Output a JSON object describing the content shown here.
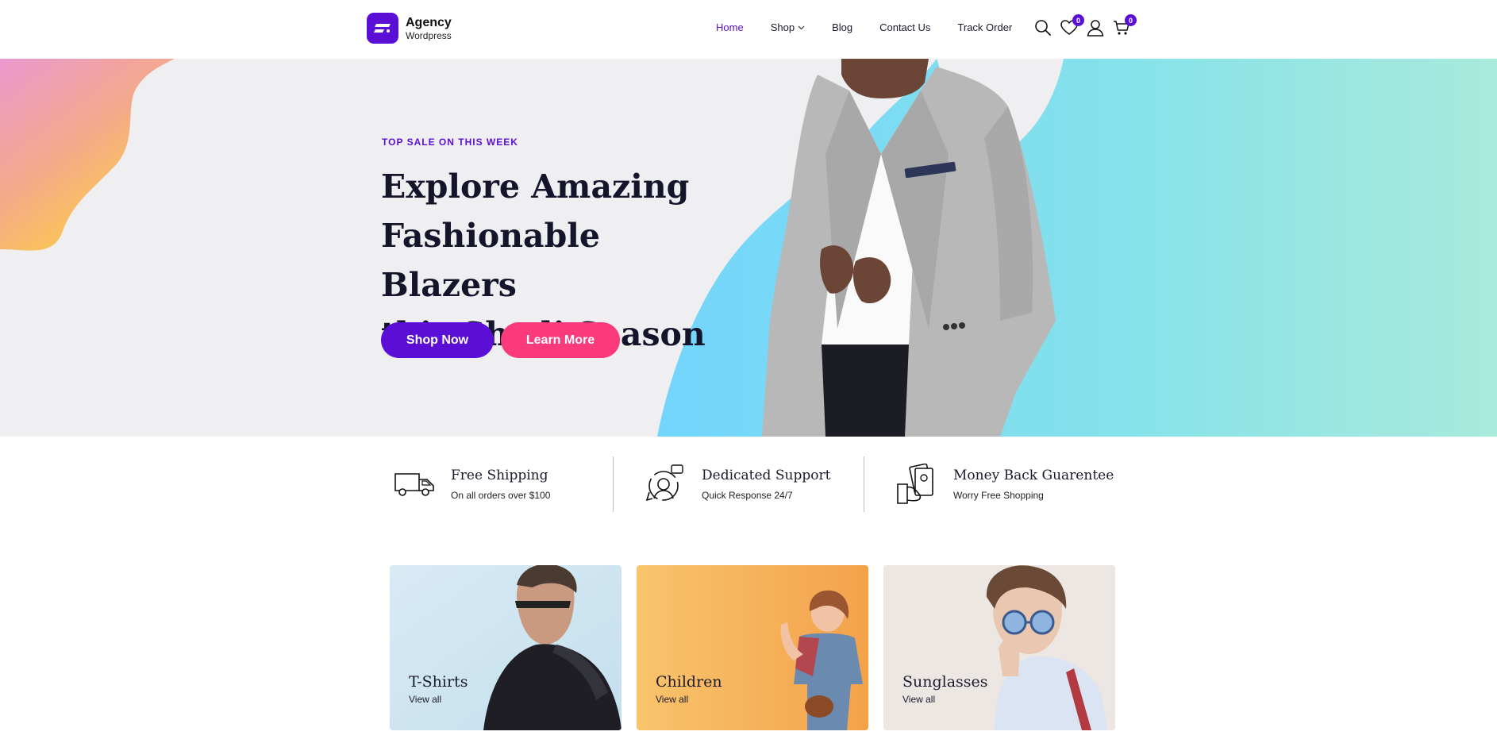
{
  "header": {
    "logo_title": "Agency",
    "logo_sub": "Wordpress",
    "nav": [
      {
        "label": "Home",
        "active": true
      },
      {
        "label": "Shop",
        "dropdown": true
      },
      {
        "label": "Blog"
      },
      {
        "label": "Contact Us"
      },
      {
        "label": "Track Order"
      }
    ],
    "wishlist_count": "0",
    "cart_count": "0",
    "icons": [
      "search-icon",
      "heart-icon",
      "user-icon",
      "cart-icon",
      "chevron-down-icon"
    ]
  },
  "hero": {
    "kicker": "TOP SALE ON THIS WEEK",
    "title_lines": [
      "Explore Amazing",
      "Fashionable Blazers",
      "this Shadi Season"
    ],
    "primary_button": "Shop Now",
    "secondary_button": "Learn More"
  },
  "features": [
    {
      "icon": "truck-icon",
      "title": "Free Shipping",
      "subtitle": "On all orders over $100"
    },
    {
      "icon": "support-agent-icon",
      "title": "Dedicated Support",
      "subtitle": "Quick Response 24/7"
    },
    {
      "icon": "money-back-icon",
      "title": "Money Back Guarentee",
      "subtitle": "Worry Free Shopping"
    }
  ],
  "categories": [
    {
      "title": "T-Shirts",
      "link": "View all"
    },
    {
      "title": "Children",
      "link": "View all"
    },
    {
      "title": "Sunglasses",
      "link": "View all"
    }
  ],
  "colors": {
    "brand": "#5b0fd6",
    "accent": "#fa3a7b",
    "hero_bg": "#efeff1"
  }
}
